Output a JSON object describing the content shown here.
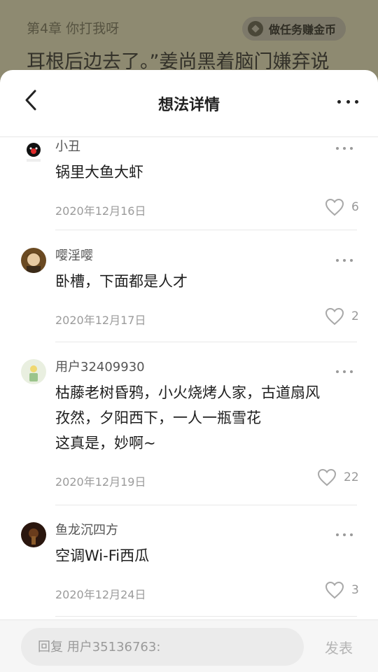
{
  "reader": {
    "chapter": "第4章 你打我呀",
    "task_button": "做任务赚金币",
    "line": "耳根后边去了。”姜尚黑着脑门嫌弃说"
  },
  "sheet": {
    "title": "想法详情"
  },
  "comments": [
    {
      "user": "小丑",
      "text": [
        "锅里大鱼大虾"
      ],
      "date": "2020年12月16日",
      "likes": "6"
    },
    {
      "user": "嘤淫嘤",
      "text": [
        "卧槽，下面都是人才"
      ],
      "date": "2020年12月17日",
      "likes": "2"
    },
    {
      "user": "用户32409930",
      "text": [
        "枯藤老树昏鸦，小火烧烤人家，古道扇风",
        "孜然，夕阳西下，一人一瓶雪花",
        "这真是，妙啊~"
      ],
      "date": "2020年12月19日",
      "likes": "22"
    },
    {
      "user": "鱼龙沉四方",
      "text": [
        "空调Wi-Fi西瓜"
      ],
      "date": "2020年12月24日",
      "likes": "3"
    }
  ],
  "reply": {
    "placeholder": "回复 用户35136763:",
    "send_label": "发表"
  }
}
